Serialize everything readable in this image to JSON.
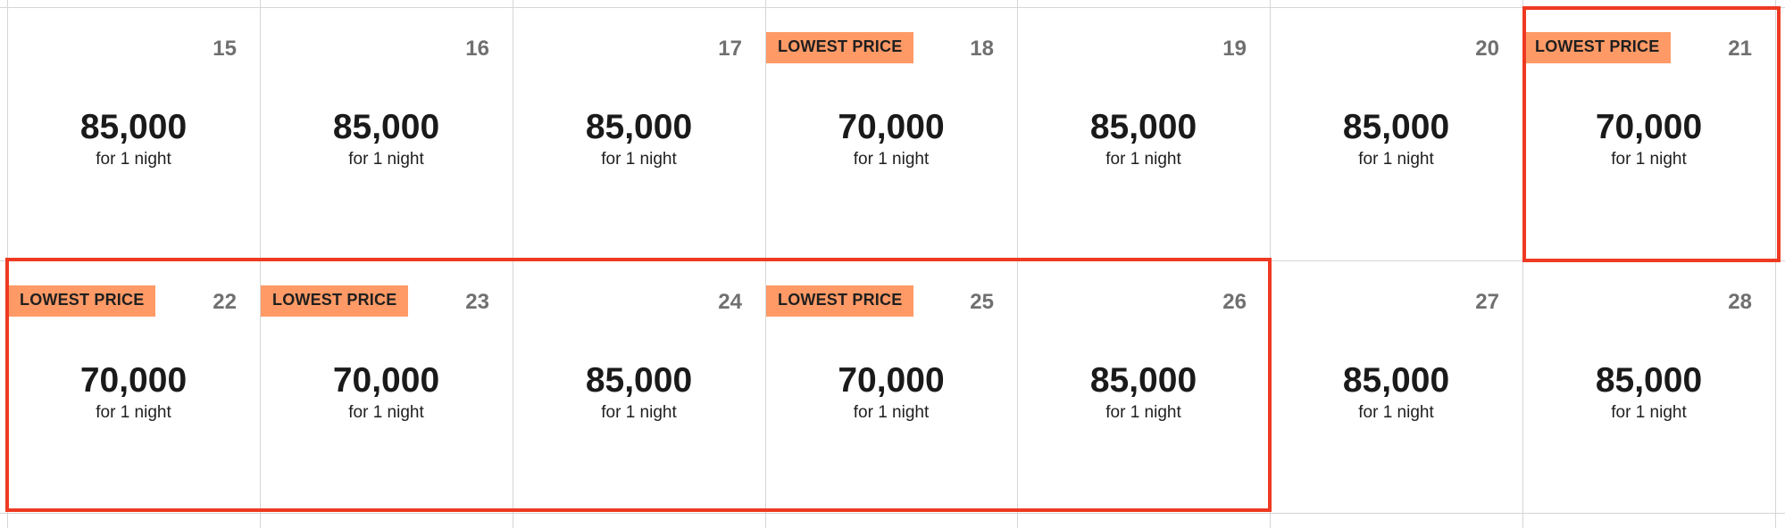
{
  "calendar": {
    "weeks": [
      {
        "days": [
          {
            "date": "15",
            "price": "85,000",
            "nights": "for 1 night",
            "badge": ""
          },
          {
            "date": "16",
            "price": "85,000",
            "nights": "for 1 night",
            "badge": ""
          },
          {
            "date": "17",
            "price": "85,000",
            "nights": "for 1 night",
            "badge": ""
          },
          {
            "date": "18",
            "price": "70,000",
            "nights": "for 1 night",
            "badge": "LOWEST PRICE"
          },
          {
            "date": "19",
            "price": "85,000",
            "nights": "for 1 night",
            "badge": ""
          },
          {
            "date": "20",
            "price": "85,000",
            "nights": "for 1 night",
            "badge": ""
          },
          {
            "date": "21",
            "price": "70,000",
            "nights": "for 1 night",
            "badge": "LOWEST PRICE"
          }
        ]
      },
      {
        "days": [
          {
            "date": "22",
            "price": "70,000",
            "nights": "for 1 night",
            "badge": "LOWEST PRICE"
          },
          {
            "date": "23",
            "price": "70,000",
            "nights": "for 1 night",
            "badge": "LOWEST PRICE"
          },
          {
            "date": "24",
            "price": "85,000",
            "nights": "for 1 night",
            "badge": ""
          },
          {
            "date": "25",
            "price": "70,000",
            "nights": "for 1 night",
            "badge": "LOWEST PRICE"
          },
          {
            "date": "26",
            "price": "85,000",
            "nights": "for 1 night",
            "badge": ""
          },
          {
            "date": "27",
            "price": "85,000",
            "nights": "for 1 night",
            "badge": ""
          },
          {
            "date": "28",
            "price": "85,000",
            "nights": "for 1 night",
            "badge": ""
          }
        ]
      }
    ]
  },
  "colors": {
    "badge_bg": "#ff9a66",
    "highlight_border": "#ee3a22",
    "date_text": "#707070",
    "price_text": "#1a1a1a"
  }
}
